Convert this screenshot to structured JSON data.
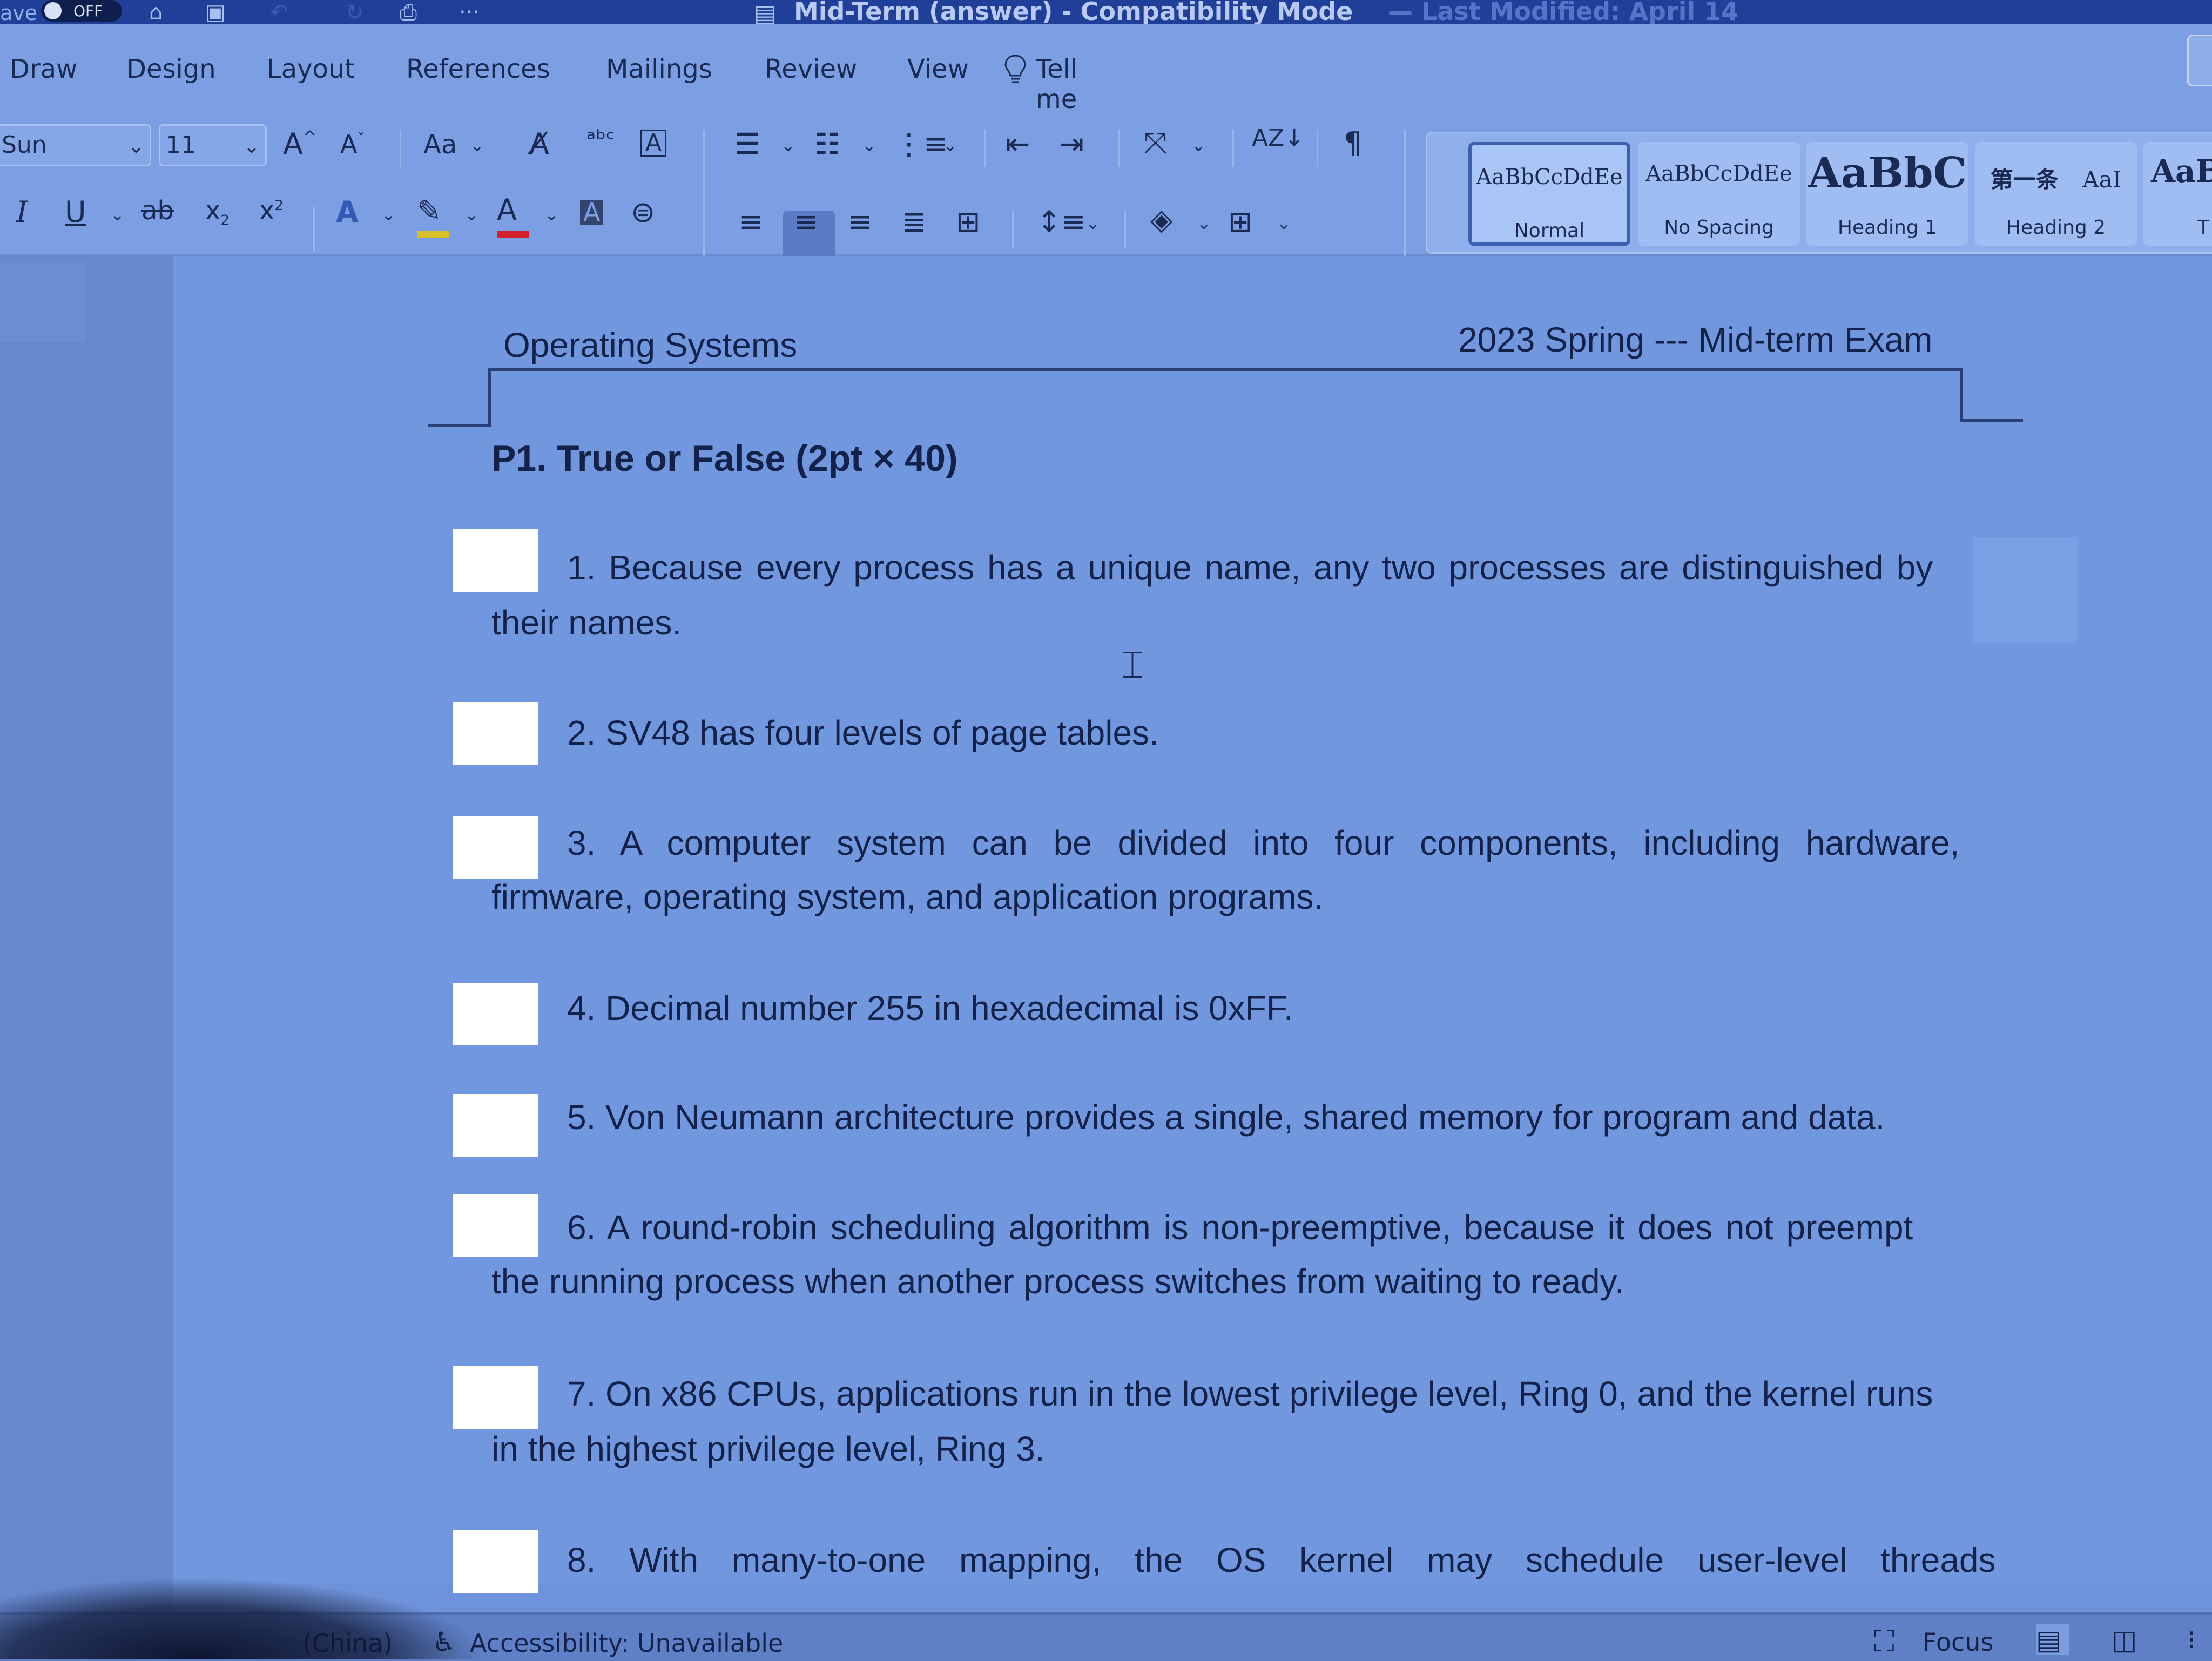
{
  "titlebar": {
    "autosave_label": "ave",
    "autosave_state": "OFF",
    "document_title": "Mid-Term (answer)  -  Compatibility Mode",
    "last_modified": "— Last Modified: April 14"
  },
  "ribbon": {
    "tabs": [
      "Draw",
      "Design",
      "Layout",
      "References",
      "Mailings",
      "Review",
      "View"
    ],
    "tell_me": "Tell me",
    "font_name": "Sun",
    "font_size": "11",
    "change_case_label": "Aa",
    "styles": [
      {
        "preview": "AaBbCcDdEe",
        "name": "Normal"
      },
      {
        "preview": "AaBbCcDdEe",
        "name": "No Spacing"
      },
      {
        "preview": "AaBbC",
        "name": "Heading 1"
      },
      {
        "preview": "第一条",
        "preview2": "AaI",
        "name": "Heading 2"
      },
      {
        "preview": "AaB",
        "name": "T"
      }
    ]
  },
  "document": {
    "header_left": "Operating Systems",
    "header_right": "2023 Spring --- Mid-term Exam",
    "section_title": "P1. True or False (2pt × 40)",
    "questions": [
      {
        "lines": [
          "1. Because every process has a unique name, any two processes are distinguished by",
          "their names."
        ]
      },
      {
        "lines": [
          "2. SV48 has four levels of page tables."
        ]
      },
      {
        "lines": [
          "3. A computer system can be divided into four components, including hardware,",
          "firmware, operating system, and application programs."
        ]
      },
      {
        "lines": [
          "4. Decimal number 255 in hexadecimal is 0xFF."
        ]
      },
      {
        "lines": [
          "5. Von Neumann architecture provides a single, shared memory for program and data."
        ]
      },
      {
        "lines": [
          "6. A round-robin scheduling algorithm is non-preemptive, because it does not preempt",
          "the running process when another process switches from waiting to ready."
        ]
      },
      {
        "lines": [
          "7. On x86 CPUs, applications run in the lowest privilege level, Ring 0, and the kernel runs",
          "in the highest privilege level, Ring 3."
        ]
      },
      {
        "lines": [
          "8. With many-to-one mapping, the OS kernel may schedule user-level threads"
        ]
      }
    ]
  },
  "statusbar": {
    "language": "(China)",
    "accessibility": "Accessibility: Unavailable",
    "focus": "Focus"
  },
  "colors": {
    "titlebar": "#1f3f99",
    "ribbon": "#7c9fe3",
    "page": "#7197df",
    "answer_box": "#ffffff"
  }
}
